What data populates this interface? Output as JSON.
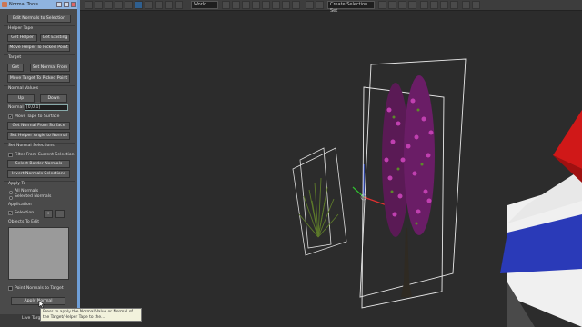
{
  "toolbar": {
    "ref_coord": "World",
    "named_selection": "Create Selection Set"
  },
  "panel": {
    "title": "Normal Tools",
    "edit_normals_button": "Edit Normals to Selection",
    "helper_tape": {
      "heading": "Helper Tape",
      "get_helper": "Get Helper",
      "get_existing": "Get Existing",
      "move_helper": "Move Helper To Picked Point"
    },
    "target": {
      "heading": "Target",
      "get": "Get",
      "set_normal_from": "Set Normal From",
      "move_target": "Move Target To Picked Point"
    },
    "normal_values": {
      "heading": "Normal Values",
      "up": "Up",
      "down": "Down",
      "normal_label": "Normal",
      "normal_value": "[0,0,1]",
      "move_tape_label": "Move Tape to Surface",
      "get_normal_from_surface": "Get Normal From Surface",
      "set_helper_angle": "Set Helper Angle to Normal"
    },
    "set_normal_selections": {
      "heading": "Set Normal Selections",
      "filter_label": "Filter From Current Selection",
      "select_border": "Select Border Normals",
      "invert": "Invert Normals Selections"
    },
    "apply_to": {
      "heading": "Apply To",
      "all_normals": "All Normals",
      "selected_normals": "Selected Normals"
    },
    "application": {
      "heading": "Application",
      "selection_label": "Selection",
      "plus": "+",
      "minus": "-"
    },
    "objects_to_edit": {
      "heading": "Objects To Edit"
    },
    "point_normals_label": "Point Normals to Target",
    "apply_normal": "Apply Normal",
    "live_target": "Live Target",
    "tooltip": "Press to apply the Normal Value or Normal of the Target/Helper Tape to the..."
  }
}
